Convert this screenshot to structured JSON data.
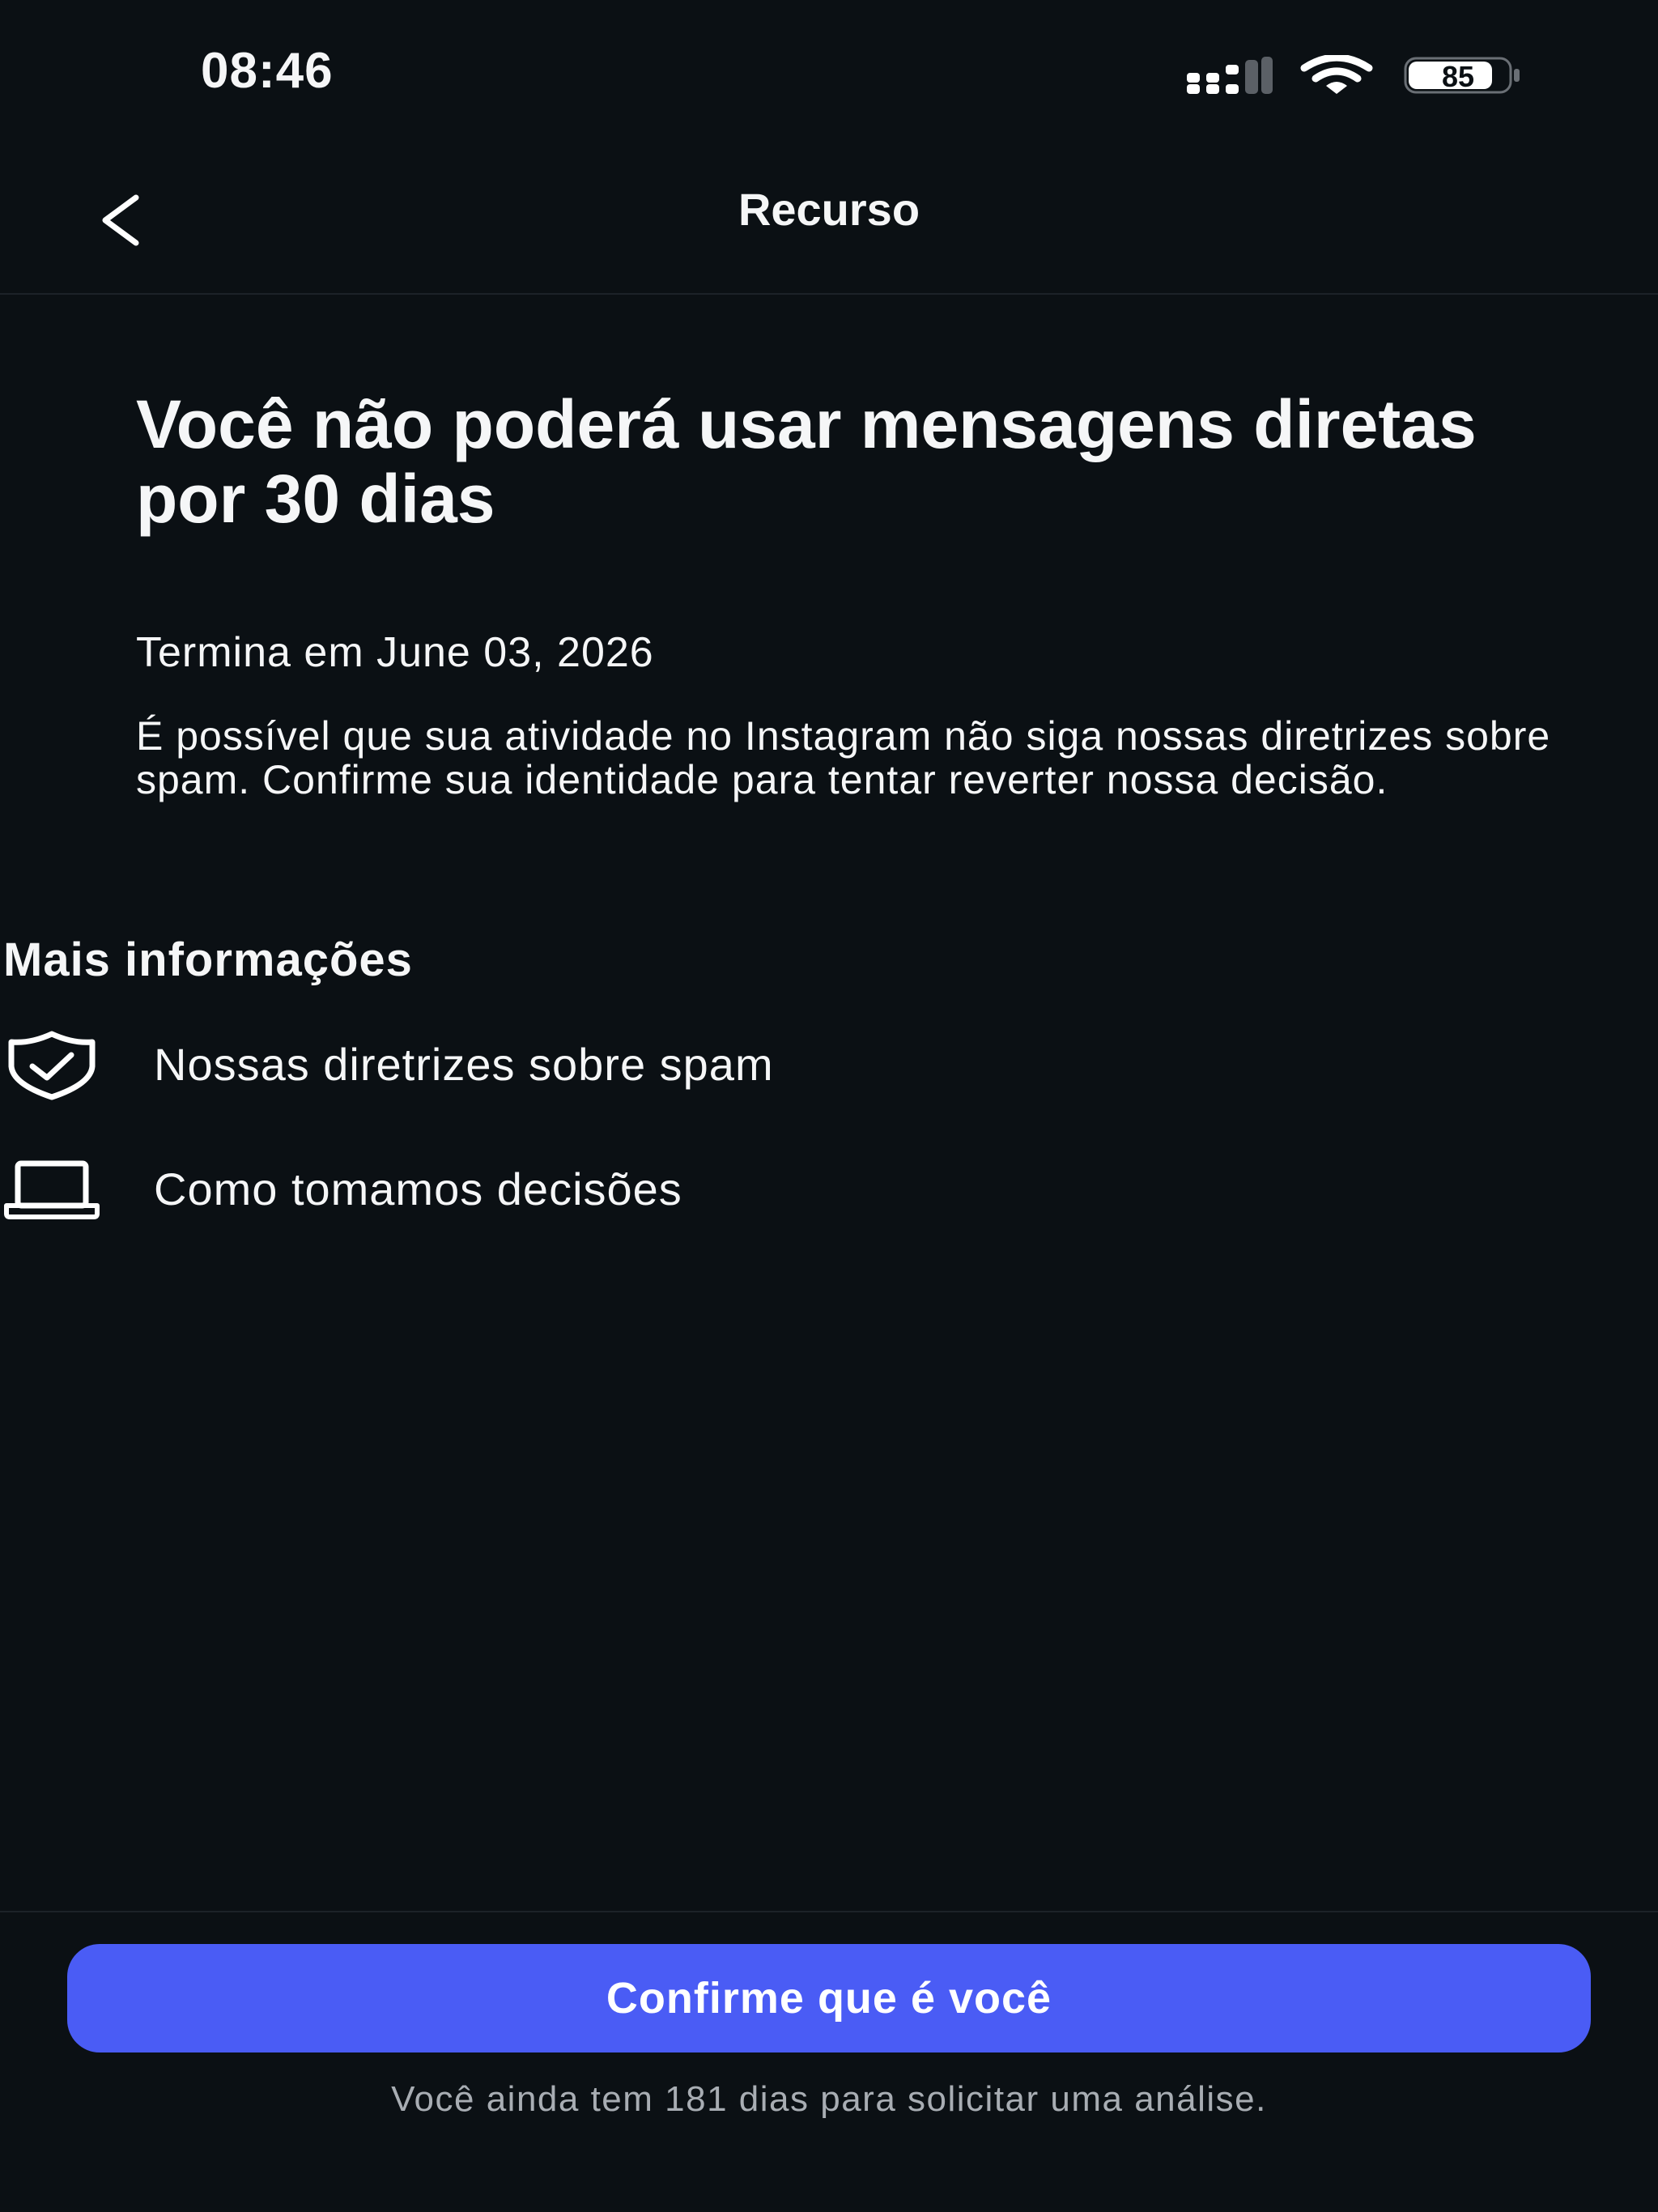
{
  "status_bar": {
    "time": "08:46",
    "battery_level": "85",
    "icons": [
      "signal-icon",
      "wifi-icon",
      "battery-icon"
    ]
  },
  "nav": {
    "title": "Recurso",
    "back_icon": "chevron-left-icon"
  },
  "content": {
    "headline": "Você não poderá usar mensagens diretas por 30 dias",
    "ends_on": "Termina em June 03, 2026",
    "description": "É possível que sua atividade no Instagram não siga nossas diretrizes sobre spam. Confirme sua identidade para tentar reverter nossa decisão."
  },
  "more_info": {
    "title": "Mais informações",
    "items": [
      {
        "label": "Nossas diretrizes sobre spam",
        "icon": "shield-check-icon"
      },
      {
        "label": "Como tomamos decisões",
        "icon": "laptop-icon"
      }
    ]
  },
  "footer": {
    "confirm_label": "Confirme que é você",
    "note": "Você ainda tem 181 dias para solicitar uma análise."
  },
  "colors": {
    "background": "#0b1014",
    "primary_button": "#4a5cf5",
    "text": "#f5f6f7",
    "muted_text": "#a8adb3"
  }
}
